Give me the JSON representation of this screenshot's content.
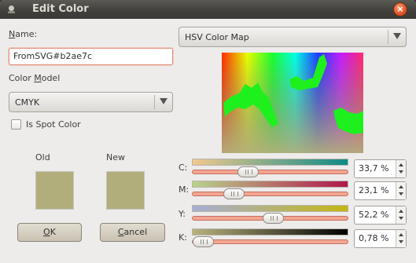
{
  "window": {
    "title": "Edit Color",
    "close_glyph": "×"
  },
  "name": {
    "label": "Name:",
    "value": "FromSVG#b2ae7c"
  },
  "color_model": {
    "label": "Color Model",
    "value": "CMYK"
  },
  "spot_color": {
    "label": "Is Spot Color",
    "checked": false
  },
  "swatches": {
    "old_label": "Old",
    "new_label": "New",
    "old_color": "#b2ae7c",
    "new_color": "#b2ae7c"
  },
  "buttons": {
    "ok": "OK",
    "cancel": "Cancel"
  },
  "map": {
    "mode": "HSV Color Map"
  },
  "sliders": [
    {
      "label": "C:",
      "value_text": "33,7 %",
      "value": 33.7,
      "from": "#f3c98f",
      "to": "#0e8a86"
    },
    {
      "label": "M:",
      "value_text": "23,1 %",
      "value": 23.1,
      "from": "#b9d38c",
      "to": "#b1174a"
    },
    {
      "label": "Y:",
      "value_text": "52,2 %",
      "value": 52.2,
      "from": "#a7aed6",
      "to": "#c3b712"
    },
    {
      "label": "K:",
      "value_text": "0,78 %",
      "value": 0.78,
      "from": "#b8b37f",
      "to": "#000000"
    }
  ],
  "icons": {
    "window": "app-window-icon",
    "close": "close-icon",
    "dropdown": "chevron-down-icon",
    "spin": "spin-arrows-icon"
  }
}
